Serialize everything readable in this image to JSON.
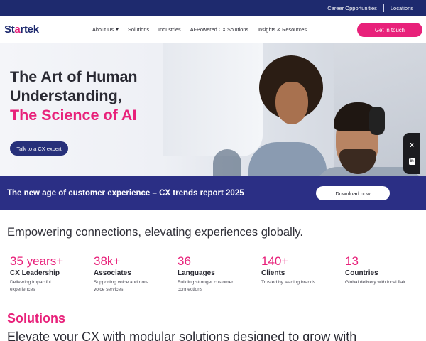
{
  "topbar": {
    "links": [
      "Career Opportunities",
      "Locations"
    ]
  },
  "header": {
    "logo": {
      "prefix": "St",
      "accent": "a",
      "suffix": "rtek"
    },
    "nav": [
      {
        "label": "About Us",
        "has_dropdown": true
      },
      {
        "label": "Solutions",
        "has_dropdown": false
      },
      {
        "label": "Industries",
        "has_dropdown": false
      },
      {
        "label": "AI-Powered CX Solutions",
        "has_dropdown": false
      },
      {
        "label": "Insights & Resources",
        "has_dropdown": false
      }
    ],
    "cta_label": "Get in touch"
  },
  "hero": {
    "title_line1": "The Art of Human",
    "title_line2": "Understanding,",
    "title_line3": "The Science of AI",
    "button_label": "Talk to a CX expert",
    "social": {
      "x_icon": "X",
      "linkedin_icon": "in"
    }
  },
  "banner": {
    "text": "The new age of customer experience – CX trends report 2025",
    "button_label": "Download now"
  },
  "tagline": "Empowering connections, elevating experiences globally.",
  "stats": [
    {
      "number": "35 years+",
      "label": "CX Leadership",
      "desc": "Delivering impactful experiences"
    },
    {
      "number": "38k+",
      "label": "Associates",
      "desc": "Supporting voice and non-voice services"
    },
    {
      "number": "36",
      "label": "Languages",
      "desc": "Building stronger customer connections"
    },
    {
      "number": "140+",
      "label": "Clients",
      "desc": "Trusted by leading brands"
    },
    {
      "number": "13",
      "label": "Countries",
      "desc": "Global delivery with local flair"
    }
  ],
  "solutions": {
    "title": "Solutions",
    "subtitle": "Elevate your CX with modular solutions designed to grow with"
  },
  "colors": {
    "navy": "#1e2a6e",
    "accent_pink": "#e8217a",
    "banner_indigo": "#2b2f85",
    "button_indigo": "#27307a"
  }
}
